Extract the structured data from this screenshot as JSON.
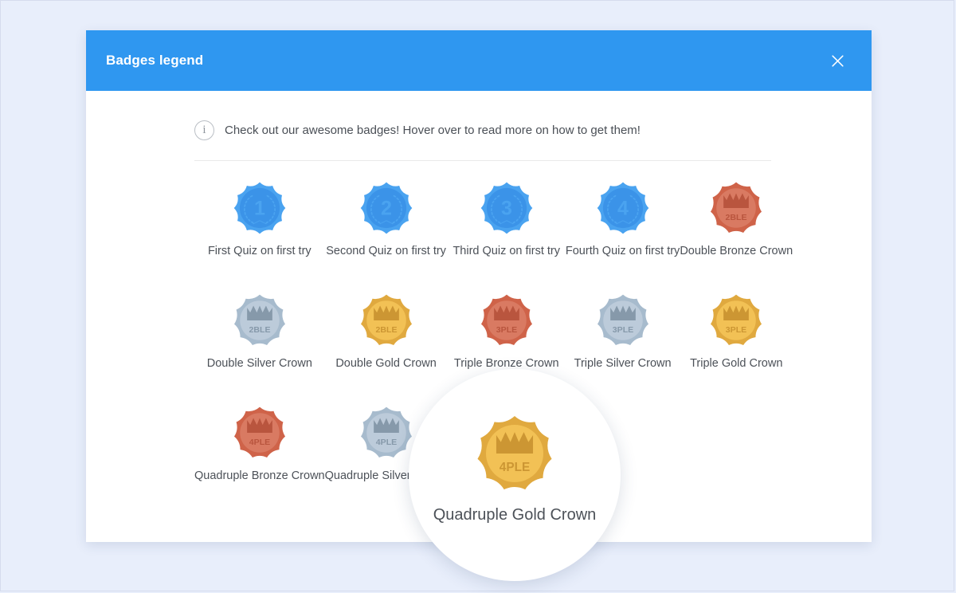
{
  "page": {
    "background_color": "#e8eefb"
  },
  "dialog": {
    "title": "Badges legend",
    "header_color": "#2f97f0",
    "close_icon": "close-icon",
    "info": {
      "icon": "info-circle-icon",
      "text": "Check out our awesome badges! Hover over to read more on how to get them!"
    }
  },
  "badges": [
    {
      "label": "First Quiz on first try",
      "art": "medal",
      "text": "1",
      "color": "#4aa3f0",
      "inner_color": "#3b93e8",
      "mark_color": "#2f97f0"
    },
    {
      "label": "Second Quiz on first try",
      "art": "medal",
      "text": "2",
      "color": "#4aa3f0",
      "inner_color": "#3b93e8",
      "mark_color": "#2f97f0"
    },
    {
      "label": "Third Quiz on first try",
      "art": "medal",
      "text": "3",
      "color": "#4aa3f0",
      "inner_color": "#3b93e8",
      "mark_color": "#2f97f0"
    },
    {
      "label": "Fourth Quiz on first try",
      "art": "medal",
      "text": "4",
      "color": "#4aa3f0",
      "inner_color": "#3b93e8",
      "mark_color": "#2f97f0"
    },
    {
      "label": "Double Bronze Crown",
      "art": "crown",
      "text": "2BLE",
      "color": "#cf6349",
      "inner_color": "#d97a62",
      "mark_color": "#b9553e"
    },
    {
      "label": "Double Silver Crown",
      "art": "crown",
      "text": "2BLE",
      "color": "#a7bbcd",
      "inner_color": "#bccbda",
      "mark_color": "#8699aa"
    },
    {
      "label": "Double Gold Crown",
      "art": "crown",
      "text": "2BLE",
      "color": "#e0a93f",
      "inner_color": "#f2c155",
      "mark_color": "#cc9633"
    },
    {
      "label": "Triple Bronze Crown",
      "art": "crown",
      "text": "3PLE",
      "color": "#cf6349",
      "inner_color": "#d97a62",
      "mark_color": "#b9553e"
    },
    {
      "label": "Triple Silver Crown",
      "art": "crown",
      "text": "3PLE",
      "color": "#a7bbcd",
      "inner_color": "#bccbda",
      "mark_color": "#8699aa"
    },
    {
      "label": "Triple Gold Crown",
      "art": "crown",
      "text": "3PLE",
      "color": "#e0a93f",
      "inner_color": "#f2c155",
      "mark_color": "#cc9633"
    },
    {
      "label": "Quadruple Bronze Crown",
      "art": "crown",
      "text": "4PLE",
      "color": "#cf6349",
      "inner_color": "#d97a62",
      "mark_color": "#b9553e"
    },
    {
      "label": "Quadruple Silver Crown",
      "art": "crown",
      "text": "4PLE",
      "color": "#a7bbcd",
      "inner_color": "#bccbda",
      "mark_color": "#8699aa"
    },
    {
      "label": "Quadruple Gold Crown",
      "art": "crown",
      "text": "4PLE",
      "color": "#e0a93f",
      "inner_color": "#f2c155",
      "mark_color": "#cc9633"
    }
  ],
  "magnifier": {
    "label": "Quadruple Gold Crown",
    "text": "4PLE",
    "art": "crown",
    "color": "#e0a93f",
    "inner_color": "#f2c155",
    "mark_color": "#cc9633"
  }
}
